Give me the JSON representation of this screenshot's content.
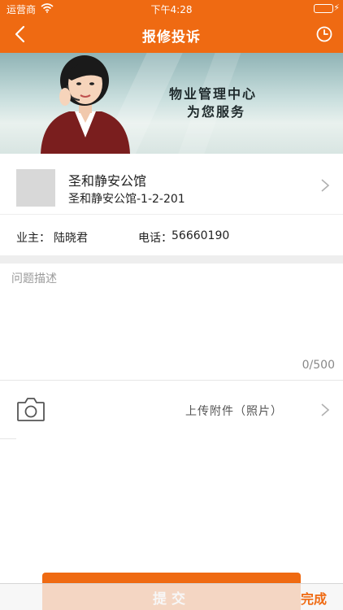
{
  "status_bar": {
    "carrier": "运营商",
    "time": "下午4:28"
  },
  "nav": {
    "title": "报修投诉",
    "back_icon": "chevron-left-icon",
    "history_icon": "clock-icon"
  },
  "banner": {
    "slogan_line1": "物业管理中心",
    "slogan_line2": "为您服务"
  },
  "property": {
    "name": "圣和静安公馆",
    "unit": "圣和静安公馆-1-2-201"
  },
  "owner": {
    "owner_label": "业主：",
    "owner_name": "陆晓君",
    "phone_label": "电话：",
    "phone_value": "56660190"
  },
  "description": {
    "placeholder": "问题描述",
    "value": "",
    "counter": "0/500"
  },
  "upload": {
    "label": "上传附件（照片）",
    "icon": "camera-icon"
  },
  "submit": {
    "label": "提交"
  },
  "keyboard_toolbar": {
    "done_label": "完成"
  },
  "colors": {
    "brand": "#ef6a12",
    "divider": "#eeeeee",
    "placeholder": "#9a9a9a"
  }
}
